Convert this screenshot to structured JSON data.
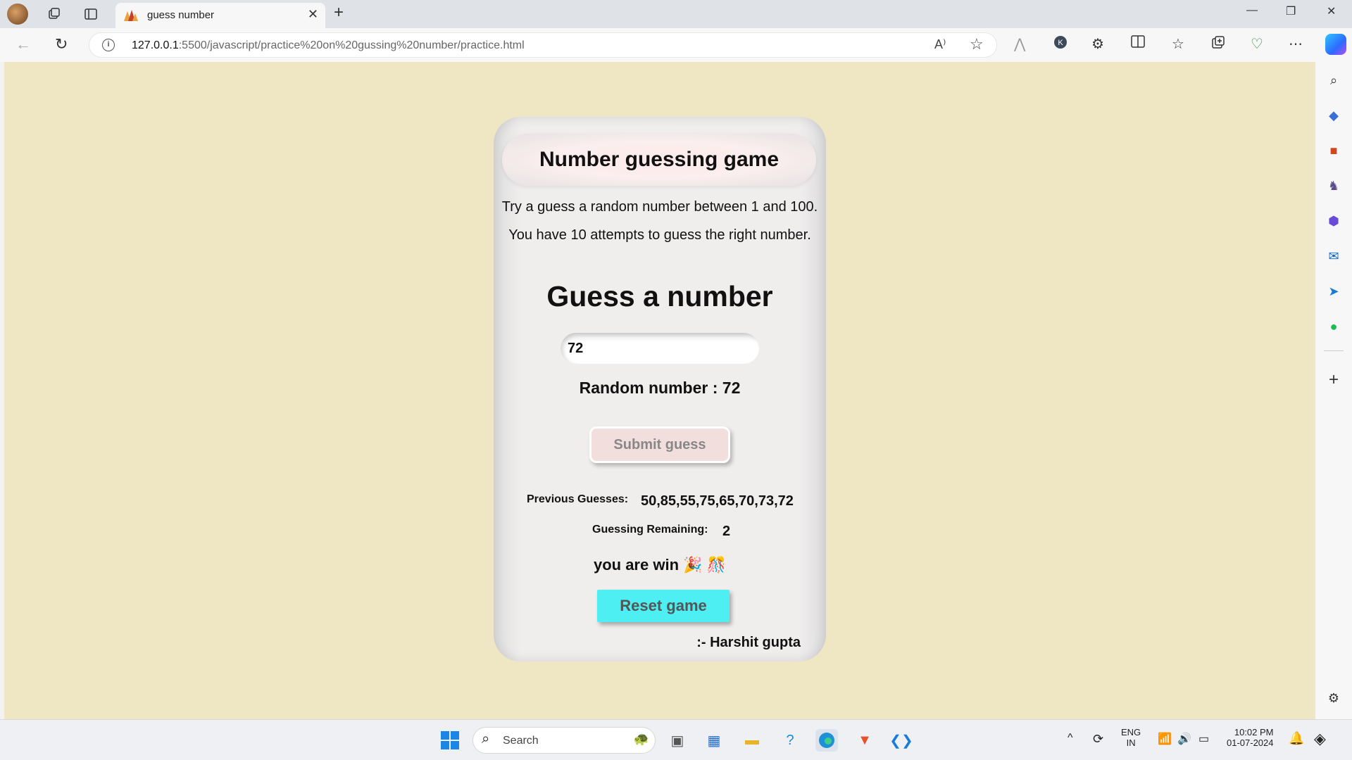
{
  "browser": {
    "tab_title": "guess number",
    "address": {
      "host": "127.0.0.1",
      "path": ":5500/javascript/practice%20on%20gussing%20number/practice.html"
    }
  },
  "game": {
    "title": "Number guessing game",
    "intro_1": "Try a guess a random number between 1 and 100.",
    "intro_2": "You have 10 attempts to guess the right number.",
    "heading": "Guess a number",
    "input_value": "72",
    "random_line": "Random number : 72",
    "submit_label": "Submit guess",
    "previous_label": "Previous Guesses:",
    "previous_value": "50,85,55,75,65,70,73,72",
    "remaining_label": "Guessing Remaining:",
    "remaining_value": "2",
    "win_message": "you are win 🎉 🎊",
    "reset_label": "Reset game",
    "author": ":- Harshit gupta"
  },
  "taskbar": {
    "search_placeholder": "Search",
    "lang_1": "ENG",
    "lang_2": "IN",
    "time": "10:02 PM",
    "date": "01-07-2024"
  }
}
